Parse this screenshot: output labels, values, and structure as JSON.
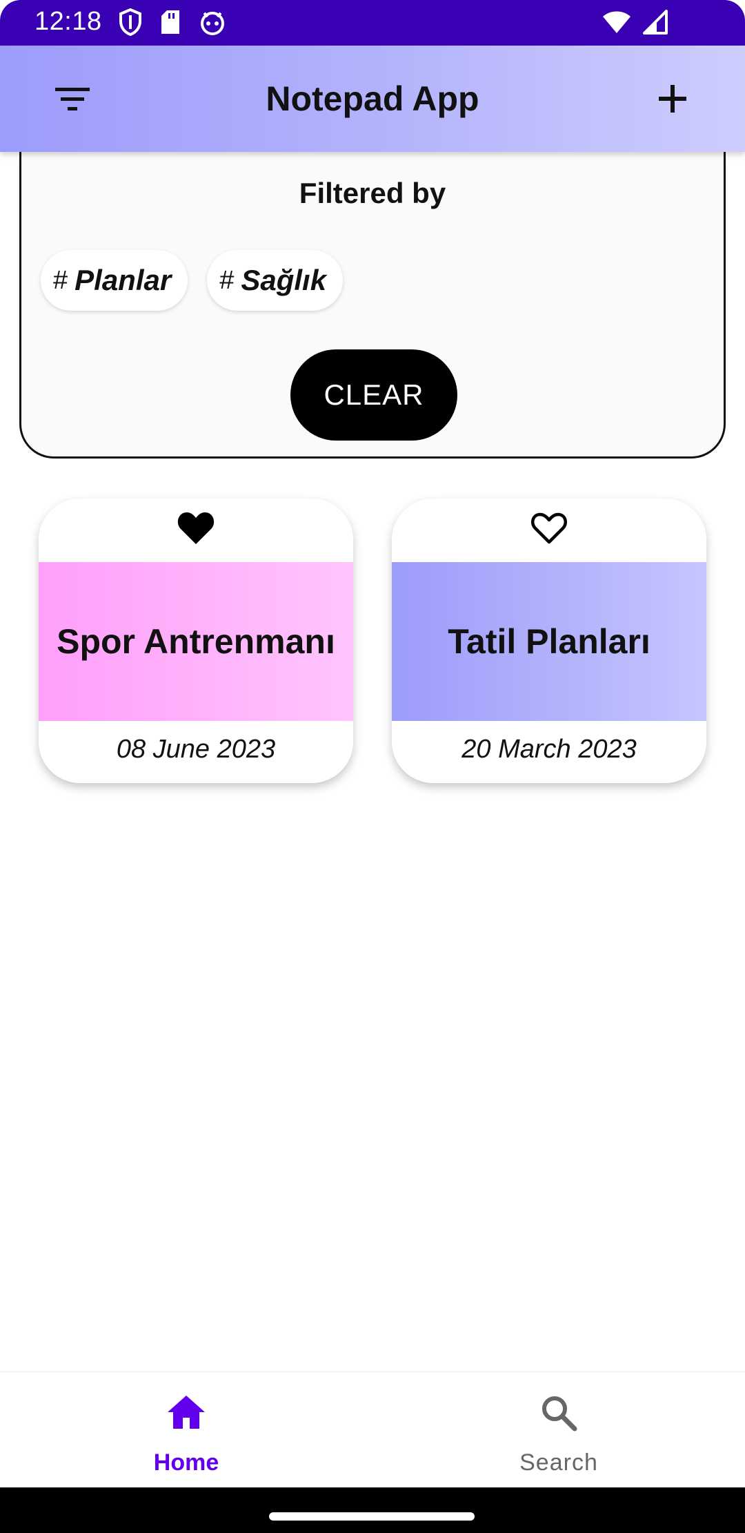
{
  "status_bar": {
    "time": "12:18",
    "icons_left": [
      "shield-icon",
      "sd-card-icon",
      "android-icon"
    ],
    "icons_right": [
      "wifi-icon",
      "cellular-signal-icon"
    ]
  },
  "app_bar": {
    "title": "Notepad App",
    "left_icon": "filter-list-icon",
    "right_icon": "add-icon",
    "gradient": [
      "#9c9cfb",
      "#cdcdfe"
    ]
  },
  "filter_panel": {
    "title": "Filtered by",
    "chips": [
      {
        "prefix": "#",
        "label": "Planlar"
      },
      {
        "prefix": "#",
        "label": "Sağlık"
      }
    ],
    "clear_label": "CLEAR"
  },
  "notes": [
    {
      "title": "Spor Antrenmanı",
      "date": "08 June 2023",
      "favorite": true,
      "color": "#ff9ff9"
    },
    {
      "title": "Tatil Planları",
      "date": "20 March 2023",
      "favorite": false,
      "color": "#9c9cfb"
    }
  ],
  "bottom_nav": {
    "items": [
      {
        "label": "Home",
        "icon": "home-icon",
        "active": true
      },
      {
        "label": "Search",
        "icon": "search-icon",
        "active": false
      }
    ],
    "active_color": "#6200ee"
  }
}
